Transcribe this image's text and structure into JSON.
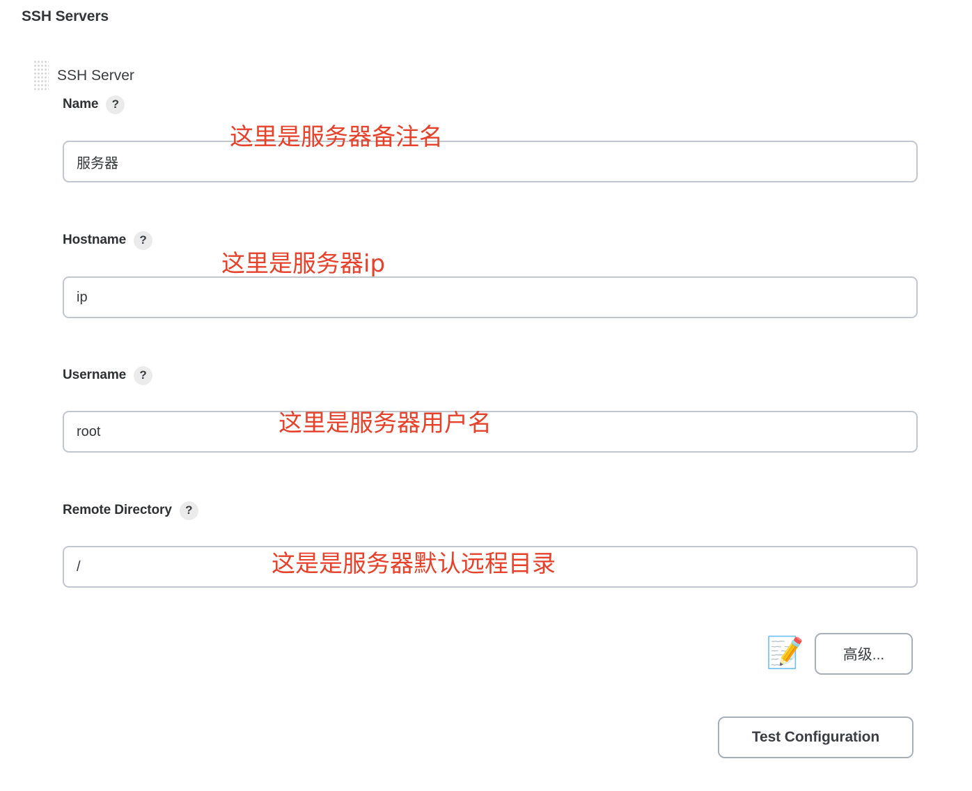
{
  "page": {
    "title": "SSH Servers"
  },
  "server": {
    "label": "SSH Server",
    "drag_handle_icon": "drag-dots-icon"
  },
  "fields": [
    {
      "label": "Name",
      "help": "?",
      "value": "服务器",
      "placeholder": "",
      "annotation": "这里是服务器备注名"
    },
    {
      "label": "Hostname",
      "help": "?",
      "value": "ip",
      "placeholder": "",
      "annotation": "这里是服务器ip"
    },
    {
      "label": "Username",
      "help": "?",
      "value": "root",
      "placeholder": "",
      "annotation": "这里是服务器用户名"
    },
    {
      "label": "Remote Directory",
      "help": "?",
      "value": "/",
      "placeholder": "",
      "annotation": "这是是服务器默认远程目录"
    }
  ],
  "buttons": {
    "advanced_label": "高级...",
    "advanced_icon": "memo-icon",
    "advanced_icon_glyph": "📝",
    "test_label": "Test Configuration"
  },
  "colors": {
    "annotation_red": "#e5412b",
    "input_border": "#c1c7cd",
    "button_border": "#a7b0b8",
    "text_dark": "#2e3033",
    "background": "#ffffff"
  }
}
